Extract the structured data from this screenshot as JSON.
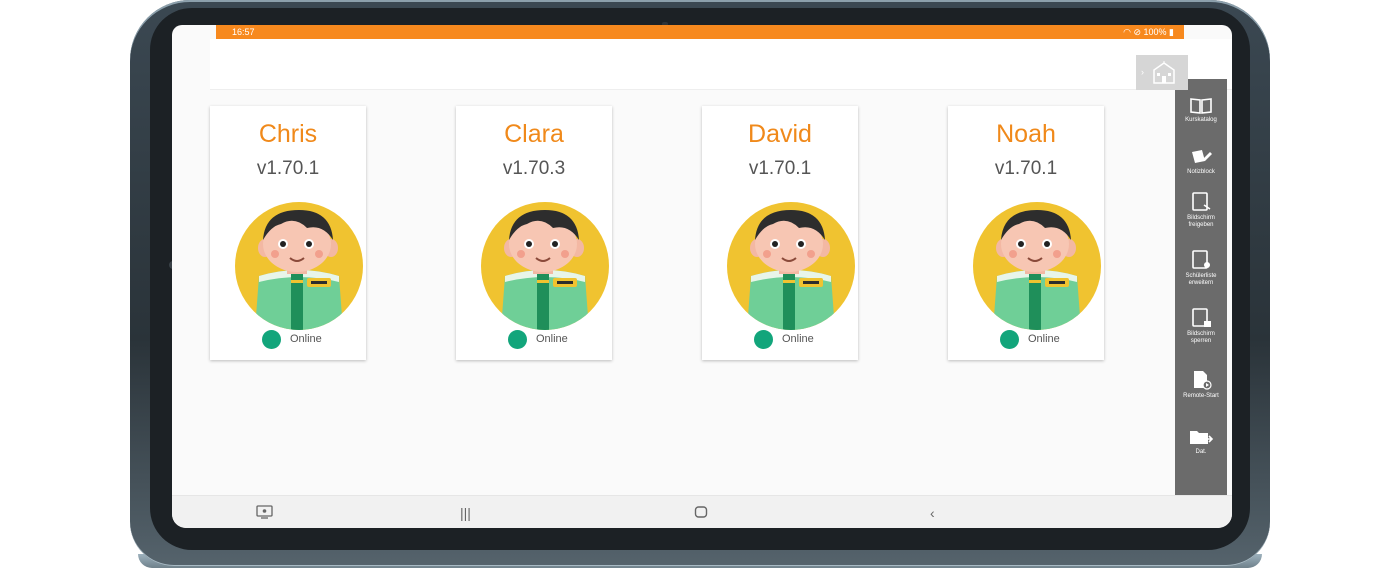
{
  "status_bar": {
    "time": "16:57",
    "battery": "100%",
    "icons": [
      "wifi-icon",
      "do-not-disturb-icon",
      "battery-icon"
    ]
  },
  "colors": {
    "status_bar": "#f7891e",
    "name": "#f0891a",
    "online": "#12a57b",
    "sidebar": "#6b6b6b",
    "avatar_bg": "#f0c330"
  },
  "students": [
    {
      "name": "Chris",
      "version": "v1.70.1",
      "status": "Online"
    },
    {
      "name": "Clara",
      "version": "v1.70.3",
      "status": "Online"
    },
    {
      "name": "David",
      "version": "v1.70.1",
      "status": "Online"
    },
    {
      "name": "Noah",
      "version": "v1.70.1",
      "status": "Online"
    }
  ],
  "sidebar": {
    "top_icon": "school-icon",
    "items": [
      {
        "label": "Kurskatalog",
        "icon": "book-icon"
      },
      {
        "label": "Notizblock",
        "icon": "notes-icon"
      },
      {
        "label": "Bildschirm freigeben",
        "icon": "screen-share-icon"
      },
      {
        "label": "Schülerliste erweitern",
        "icon": "student-list-icon"
      },
      {
        "label": "Bildschirm sperren",
        "icon": "screen-lock-icon"
      },
      {
        "label": "Remote-Start",
        "icon": "remote-start-icon"
      },
      {
        "label": "Dat.",
        "icon": "folder-send-icon"
      }
    ]
  },
  "nav_bar": [
    "screen-mirror-icon",
    "recent-apps-icon",
    "home-icon",
    "back-icon"
  ]
}
